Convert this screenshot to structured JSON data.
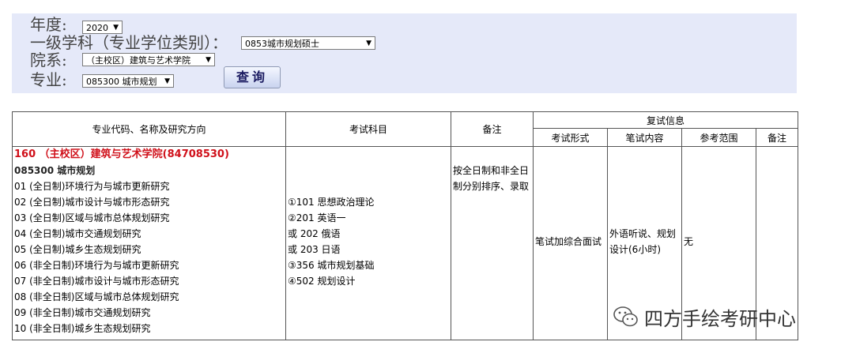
{
  "filters": {
    "year_label": "年度:",
    "year_value": "2020",
    "discipline_label": "一级学科（专业学位类别）：",
    "discipline_value": "0853城市规划硕士",
    "department_label": "院系:",
    "department_value": "（主校区）建筑与艺术学院",
    "major_label": "专业:",
    "major_value": "085300 城市规划",
    "query_button": "查询"
  },
  "table": {
    "headers": {
      "major": "专业代码、名称及研究方向",
      "subjects": "考试科目",
      "remark": "备注",
      "retest": "复试信息",
      "exam_form": "考试形式",
      "written_content": "笔试内容",
      "reference": "参考范围",
      "retest_remark": "备注"
    },
    "college": "160 （主校区）建筑与艺术学院(84708530)",
    "major": "085300 城市规划",
    "directions": [
      "01 (全日制)环境行为与城市更新研究",
      "02 (全日制)城市设计与城市形态研究",
      "03 (全日制)区域与城市总体规划研究",
      "04 (全日制)城市交通规划研究",
      "05 (全日制)城乡生态规划研究",
      "06 (非全日制)环境行为与城市更新研究",
      "07 (非全日制)城市设计与城市形态研究",
      "08 (非全日制)区域与城市总体规划研究",
      "09 (非全日制)城市交通规划研究",
      "10 (非全日制)城乡生态规划研究"
    ],
    "subjects": [
      "①101 思想政治理论",
      "②201 英语一",
      "或 202 俄语",
      "或 203 日语",
      "③356 城市规划基础",
      "④502 规划设计"
    ],
    "remark": [
      "按全日制和非全日",
      "制分别排序、录取"
    ],
    "exam_form": "笔试加综合面试",
    "written_content": [
      "外语听说、规划",
      "设计(6小时)"
    ],
    "reference": "无",
    "retest_remark": ""
  },
  "watermark": {
    "text": "四方手绘考研中心",
    "icon": "wechat-icon"
  }
}
